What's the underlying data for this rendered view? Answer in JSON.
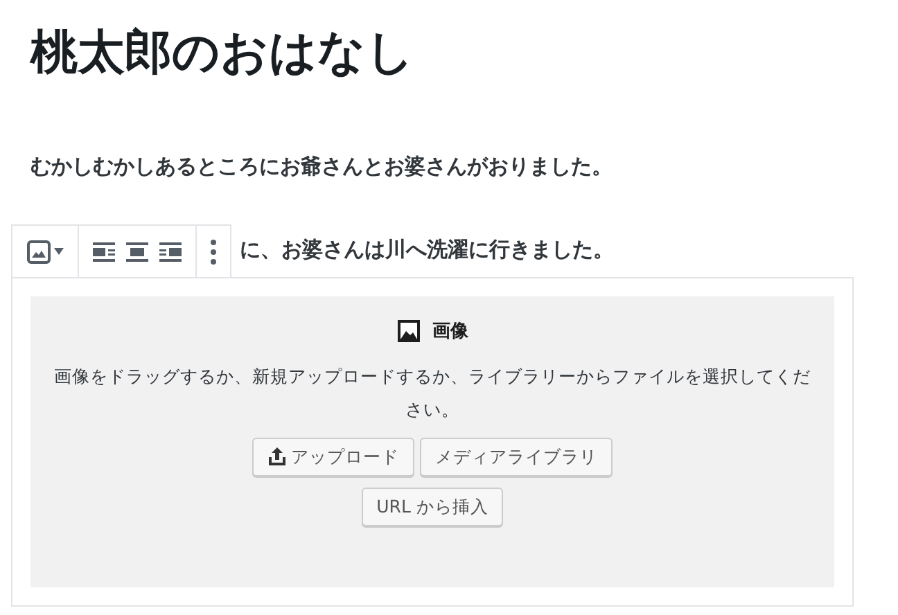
{
  "title": "桃太郎のおはなし",
  "paragraphs": [
    "むかしむかしあるところにお爺さんとお婆さんがおりました。",
    "に、お婆さんは川へ洗濯に行きました。"
  ],
  "toolbar": {
    "items": [
      {
        "kind": "block-type"
      },
      {
        "kind": "align-left",
        "selected": false
      },
      {
        "kind": "align-center",
        "selected": false
      },
      {
        "kind": "align-right",
        "selected": false
      },
      {
        "kind": "more"
      }
    ]
  },
  "image_block": {
    "label": "画像",
    "instructions": "画像をドラッグするか、新規アップロードするか、ライブラリーからファイルを選択してください。",
    "buttons": [
      {
        "kind": "upload",
        "label": "アップロード"
      },
      {
        "kind": "library",
        "label": "メディアライブラリ"
      },
      {
        "kind": "url",
        "label": "URL から挿入"
      }
    ]
  }
}
